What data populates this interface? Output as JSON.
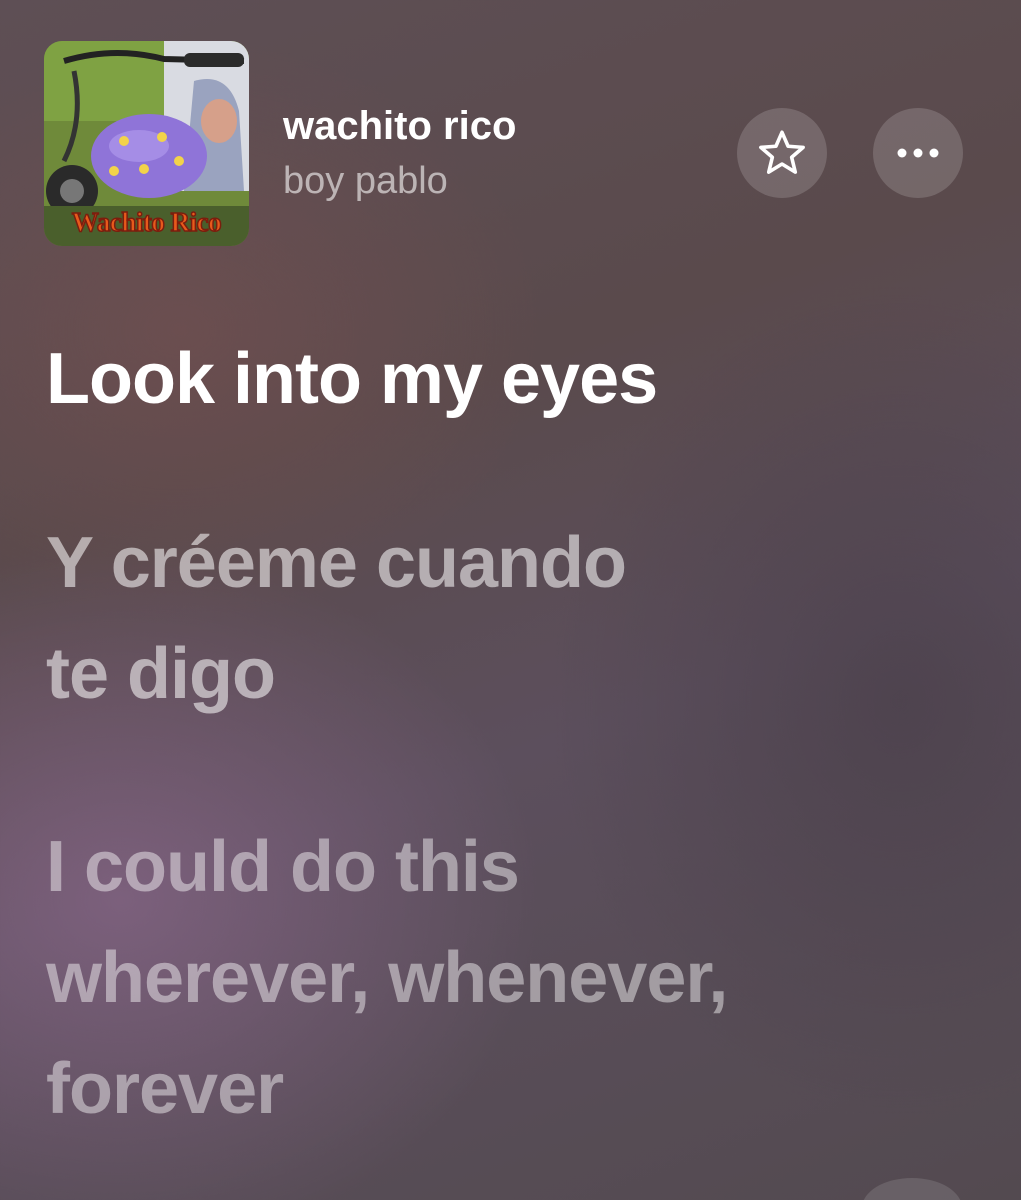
{
  "now_playing": {
    "artwork_text": "Wachito Rico",
    "title": "wachito rico",
    "artist": "boy pablo",
    "favorite_icon": "star-icon",
    "more_icon": "more-icon"
  },
  "lyrics": {
    "current": [
      "Look into my eyes"
    ],
    "next": [
      "Y créeme cuando",
      "te digo"
    ],
    "after": [
      "I could do this",
      "wherever, whenever,",
      "forever"
    ]
  },
  "colors": {
    "text_primary": "#ffffff",
    "artwork_title": "#e85a1c",
    "artwork_bike": "#8f74d8"
  }
}
